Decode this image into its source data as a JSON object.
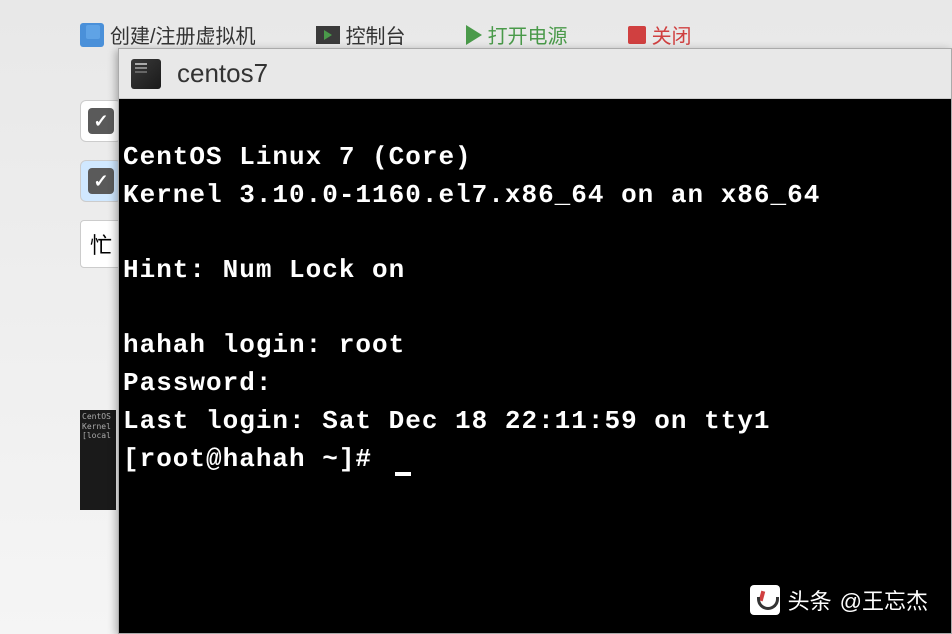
{
  "toolbar": {
    "create_vm": "创建/注册虚拟机",
    "console": "控制台",
    "power_on": "打开电源",
    "shutdown": "关闭"
  },
  "sidebar": {
    "button_label": "忙"
  },
  "thumbnail": {
    "preview_text": "CentOS\nKernel\n\n[local"
  },
  "window": {
    "title": "centos7"
  },
  "terminal": {
    "line1": "CentOS Linux 7 (Core)",
    "line2": "Kernel 3.10.0-1160.el7.x86_64 on an x86_64",
    "line3": "Hint: Num Lock on",
    "line4": "hahah login: root",
    "line5": "Password:",
    "line6": "Last login: Sat Dec 18 22:11:59 on tty1",
    "prompt": "[root@hahah ~]# "
  },
  "watermark": {
    "brand": "头条",
    "user": "@王忘杰"
  }
}
